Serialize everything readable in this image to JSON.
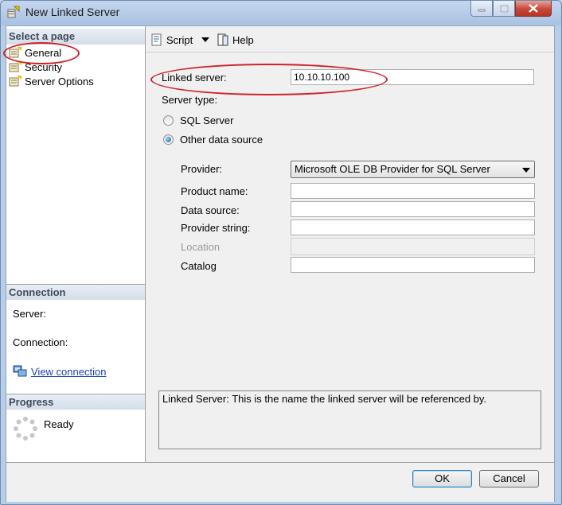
{
  "window": {
    "title": "New Linked Server"
  },
  "left": {
    "select_page_header": "Select a page",
    "pages": [
      {
        "label": "General"
      },
      {
        "label": "Security"
      },
      {
        "label": "Server Options"
      }
    ],
    "connection_header": "Connection",
    "server_label": "Server:",
    "connection_label": "Connection:",
    "view_connection_link": "View connection",
    "progress_header": "Progress",
    "progress_status": "Ready"
  },
  "toolbar": {
    "script_label": "Script",
    "help_label": "Help"
  },
  "form": {
    "linked_server_label": "Linked server:",
    "linked_server_value": "10.10.10.100",
    "server_type_label": "Server type:",
    "radio_sql_server": "SQL Server",
    "radio_other": "Other data source",
    "selected_server_type": "Other data source",
    "provider_label": "Provider:",
    "provider_value": "Microsoft OLE DB Provider for SQL Server",
    "product_name_label": "Product name:",
    "product_name_value": "",
    "data_source_label": "Data source:",
    "data_source_value": "",
    "provider_string_label": "Provider string:",
    "provider_string_value": "",
    "location_label": "Location",
    "location_value": "",
    "catalog_label": "Catalog",
    "catalog_value": ""
  },
  "description": "Linked Server: This is the name the linked server will be referenced by.",
  "buttons": {
    "ok": "OK",
    "cancel": "Cancel"
  },
  "colors": {
    "annotation_red": "#d21f26",
    "link_blue": "#1a3fb8",
    "disabled_text": "#9a9a9a"
  }
}
